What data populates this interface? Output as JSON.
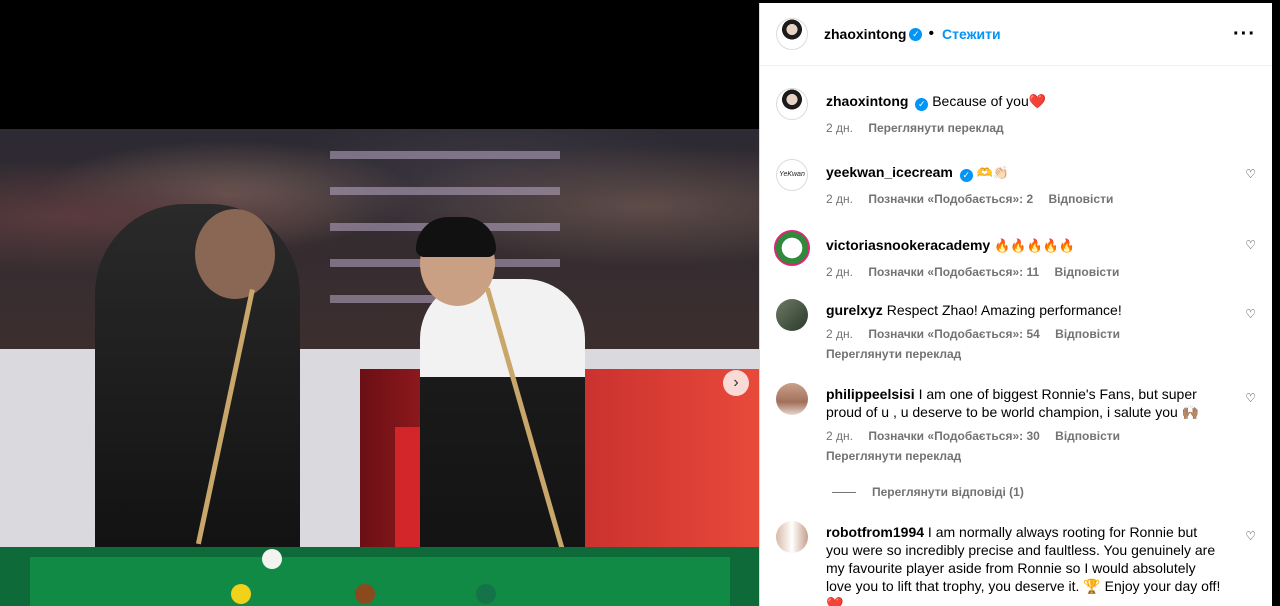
{
  "post": {
    "owner": "zhaoxintong",
    "follow_label": "Стежити",
    "dot": "•",
    "more": "···",
    "next_arrow": "›"
  },
  "caption": {
    "username": "zhaoxintong",
    "text": "Because of you",
    "emoji": "❤️",
    "time": "2 дн.",
    "translate": "Переглянути переклад"
  },
  "comments": [
    {
      "username": "yeekwan_icecream",
      "verified": true,
      "text": "🫶👏🏻",
      "avatar_text": "YeKwan",
      "time": "2 дн.",
      "likes": "Позначки «Подобається»: 2",
      "reply": "Відповісти"
    },
    {
      "username": "victoriasnookeracademy",
      "text": "🔥🔥🔥🔥🔥",
      "time": "2 дн.",
      "likes": "Позначки «Подобається»: 11",
      "reply": "Відповісти"
    },
    {
      "username": "gurelxyz",
      "text": "Respect Zhao! Amazing performance!",
      "time": "2 дн.",
      "likes": "Позначки «Подобається»: 54",
      "reply": "Відповісти",
      "translate": "Переглянути переклад"
    },
    {
      "username": "philippeelsisi",
      "text": "I am one of biggest Ronnie's Fans, but super proud of u , u deserve to be world champion, i salute you 🙌🏽",
      "time": "2 дн.",
      "likes": "Позначки «Подобається»: 30",
      "reply": "Відповісти",
      "translate": "Переглянути переклад",
      "view_replies": "Переглянути відповіді (1)"
    },
    {
      "username": "robotfrom1994",
      "text": "I am normally always rooting for Ronnie but you were so incredibly precise and faultless. You genuinely are my favourite player aside from Ronnie so I would absolutely love you to lift that trophy, you deserve it. 🏆 Enjoy your day off! ❤️"
    }
  ],
  "icons": {
    "heart": "♡",
    "verified": "✓"
  },
  "colors": {
    "accent": "#0095f6",
    "meta": "#737373"
  }
}
